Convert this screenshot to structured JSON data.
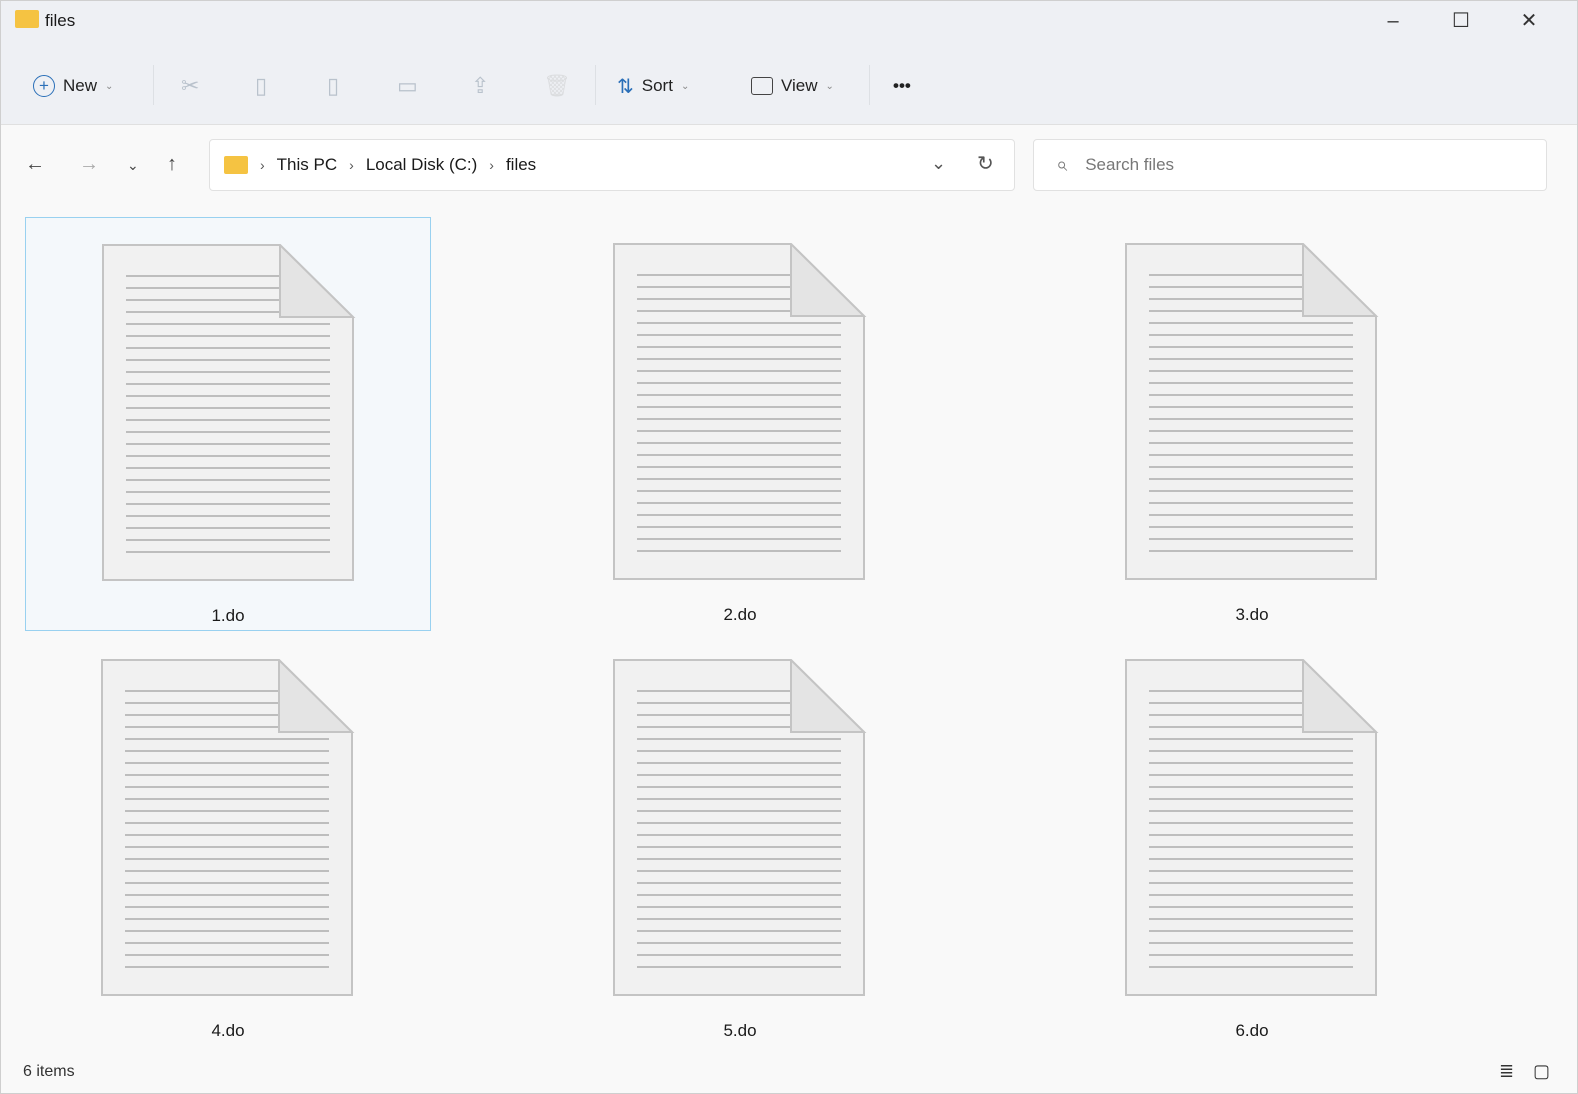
{
  "window": {
    "title": "files",
    "minimize": "–",
    "maximize": "☐",
    "close": "✕"
  },
  "toolbar": {
    "new_label": "New",
    "sort_label": "Sort",
    "view_label": "View",
    "more": "•••",
    "icons": {
      "cut": "✂",
      "copy": "▯",
      "paste": "▯",
      "rename": "▭",
      "share": "⇪",
      "delete": "🗑"
    }
  },
  "nav": {
    "back": "←",
    "forward": "→",
    "recent": "⌄",
    "up": "↑"
  },
  "address": {
    "crumbs": [
      "This PC",
      "Local Disk (C:)",
      "files"
    ],
    "dropdown": "⌄",
    "refresh": "↻"
  },
  "search": {
    "placeholder": "Search files",
    "icon": "⌕"
  },
  "files": [
    {
      "name": "1.do"
    },
    {
      "name": "2.do"
    },
    {
      "name": "3.do"
    },
    {
      "name": "4.do"
    },
    {
      "name": "5.do"
    },
    {
      "name": "6.do"
    }
  ],
  "status": {
    "count": "6 items",
    "details_icon": "≣",
    "tiles_icon": "▢"
  }
}
